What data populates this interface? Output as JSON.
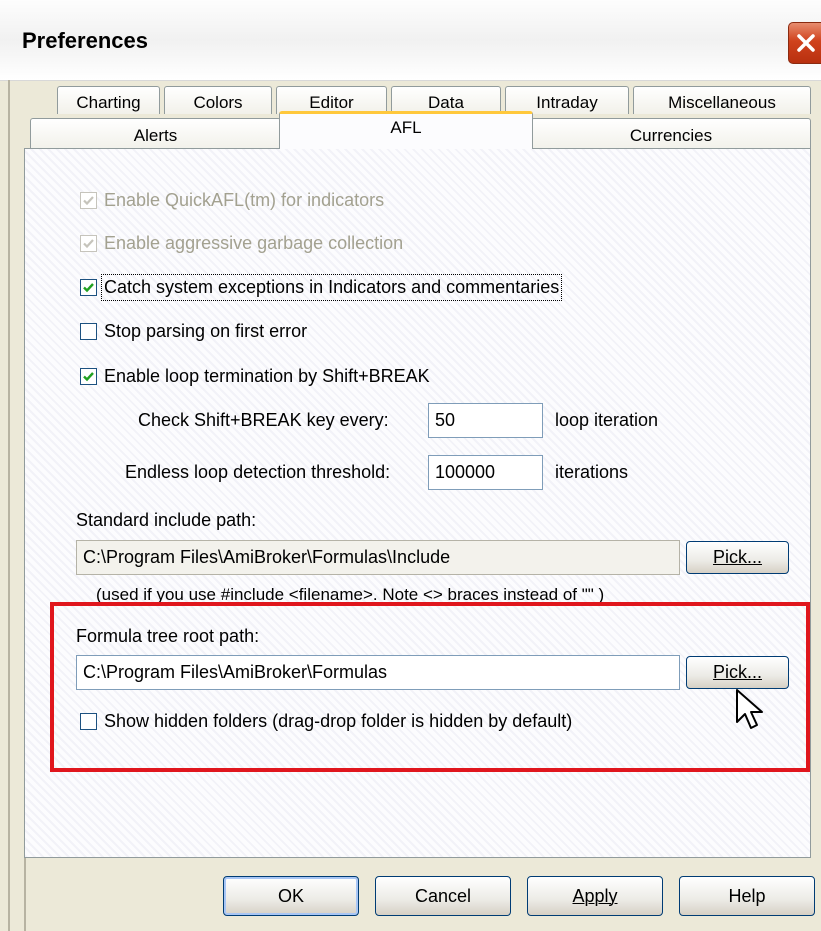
{
  "window": {
    "title": "Preferences",
    "close_icon": "close-icon"
  },
  "tabs_back": [
    "Charting",
    "Colors",
    "Editor",
    "Data",
    "Intraday",
    "Miscellaneous"
  ],
  "tabs_front": [
    "Alerts",
    "AFL",
    "Currencies"
  ],
  "active_tab": "AFL",
  "options": {
    "quick_afl": {
      "label": "Enable QuickAFL(tm) for indicators",
      "checked": true,
      "enabled": false
    },
    "aggressive_gc": {
      "label": "Enable aggressive garbage collection",
      "checked": true,
      "enabled": false
    },
    "catch_exceptions": {
      "label": "Catch system exceptions in Indicators and commentaries",
      "checked": true,
      "enabled": true
    },
    "stop_parsing": {
      "label": "Stop parsing on first error",
      "checked": false,
      "enabled": true
    },
    "loop_termination": {
      "label": "Enable loop termination by Shift+BREAK",
      "checked": true,
      "enabled": true
    }
  },
  "check_break": {
    "label": "Check Shift+BREAK key every:",
    "value": "50",
    "suffix": "loop iteration"
  },
  "endless_loop": {
    "label": "Endless loop detection threshold:",
    "value": "100000",
    "suffix": "iterations"
  },
  "include_path": {
    "label": "Standard include path:",
    "value": "C:\\Program Files\\AmiBroker\\Formulas\\Include",
    "pick": "Pick...",
    "note": "(used if you use #include <filename>. Note <> braces instead of \"\" )"
  },
  "formula_tree": {
    "label": "Formula tree root path:",
    "value": "C:\\Program Files\\AmiBroker\\Formulas",
    "pick": "Pick...",
    "show_hidden": "Show hidden folders (drag-drop folder is hidden by default)"
  },
  "buttons": {
    "ok": "OK",
    "cancel": "Cancel",
    "apply": "Apply",
    "help": "Help"
  },
  "colors": {
    "highlight": "#e0161d",
    "tab_active_accent": "#ffc83c",
    "check": "#21a121"
  }
}
